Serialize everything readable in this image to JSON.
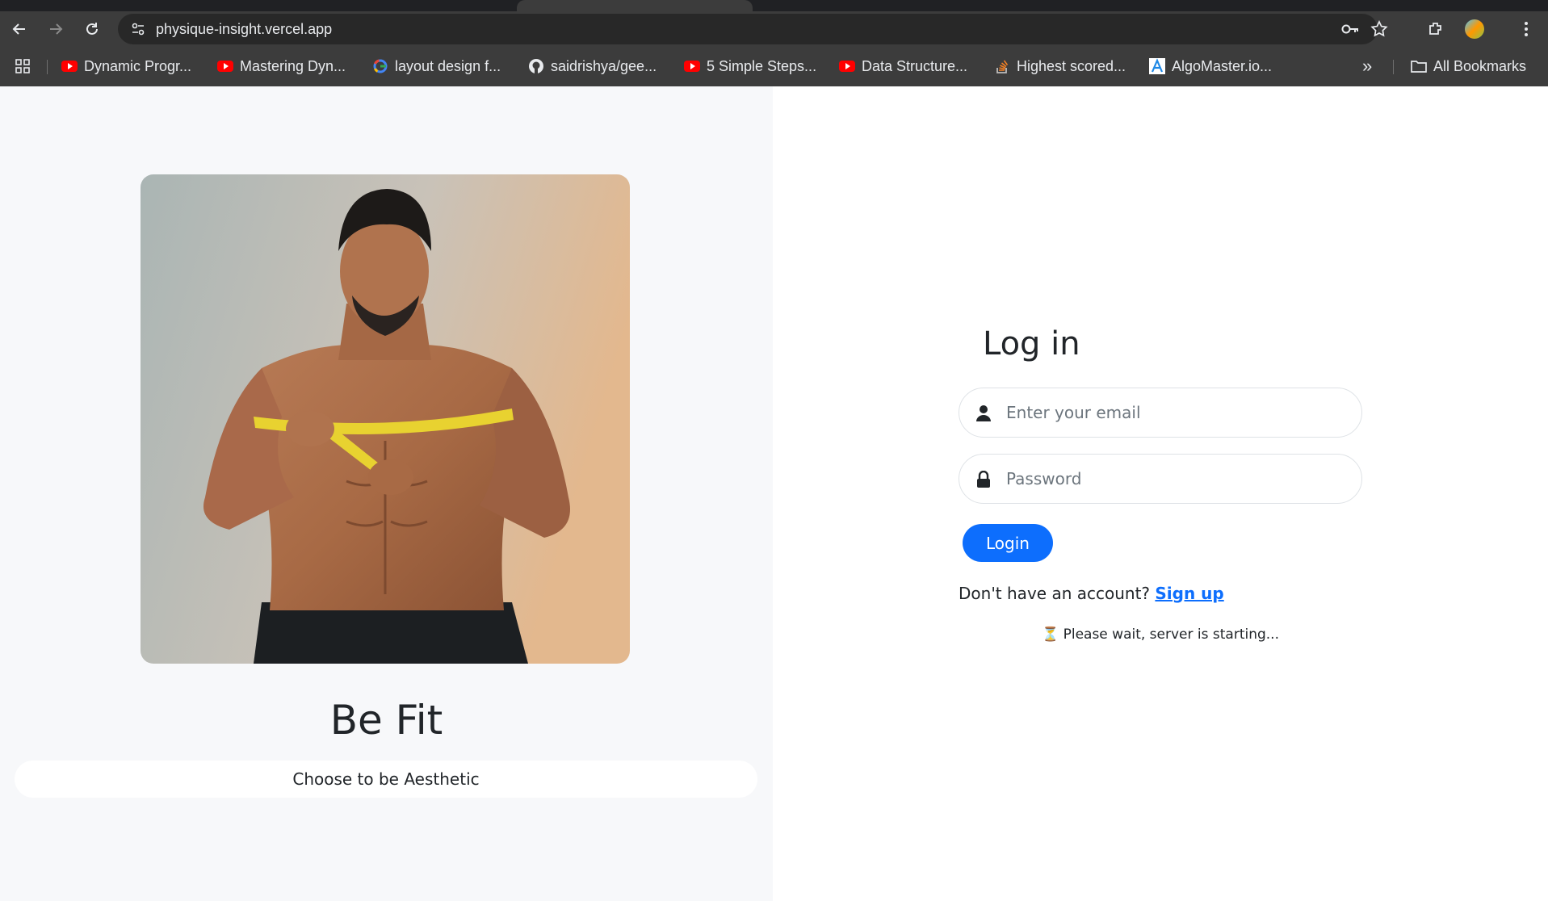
{
  "browser": {
    "url": "physique-insight.vercel.app",
    "bookmarks": [
      {
        "label": "Dynamic Progr...",
        "icon": "youtube-icon"
      },
      {
        "label": "Mastering Dyn...",
        "icon": "youtube-icon"
      },
      {
        "label": "layout design f...",
        "icon": "google-icon"
      },
      {
        "label": "saidrishya/gee...",
        "icon": "github-icon"
      },
      {
        "label": "5 Simple Steps...",
        "icon": "youtube-icon"
      },
      {
        "label": "Data Structure...",
        "icon": "youtube-icon"
      },
      {
        "label": "Highest scored...",
        "icon": "stackoverflow-icon"
      },
      {
        "label": "AlgoMaster.io...",
        "icon": "algomaster-icon"
      }
    ],
    "all_bookmarks_label": "All Bookmarks",
    "overflow_label": "»"
  },
  "brand": {
    "title": "Be Fit",
    "tagline": "Choose to be Aesthetic"
  },
  "login": {
    "title": "Log in",
    "email_placeholder": "Enter your email",
    "password_placeholder": "Password",
    "submit_label": "Login",
    "no_account_text": "Don't have an account?",
    "signup_label": "Sign up",
    "status_icon": "⏳",
    "status_text": "Please wait, server is starting..."
  },
  "colors": {
    "accent": "#0d6efd",
    "left_bg": "#f7f8fa",
    "chrome_bg": "#3c3c3c"
  }
}
